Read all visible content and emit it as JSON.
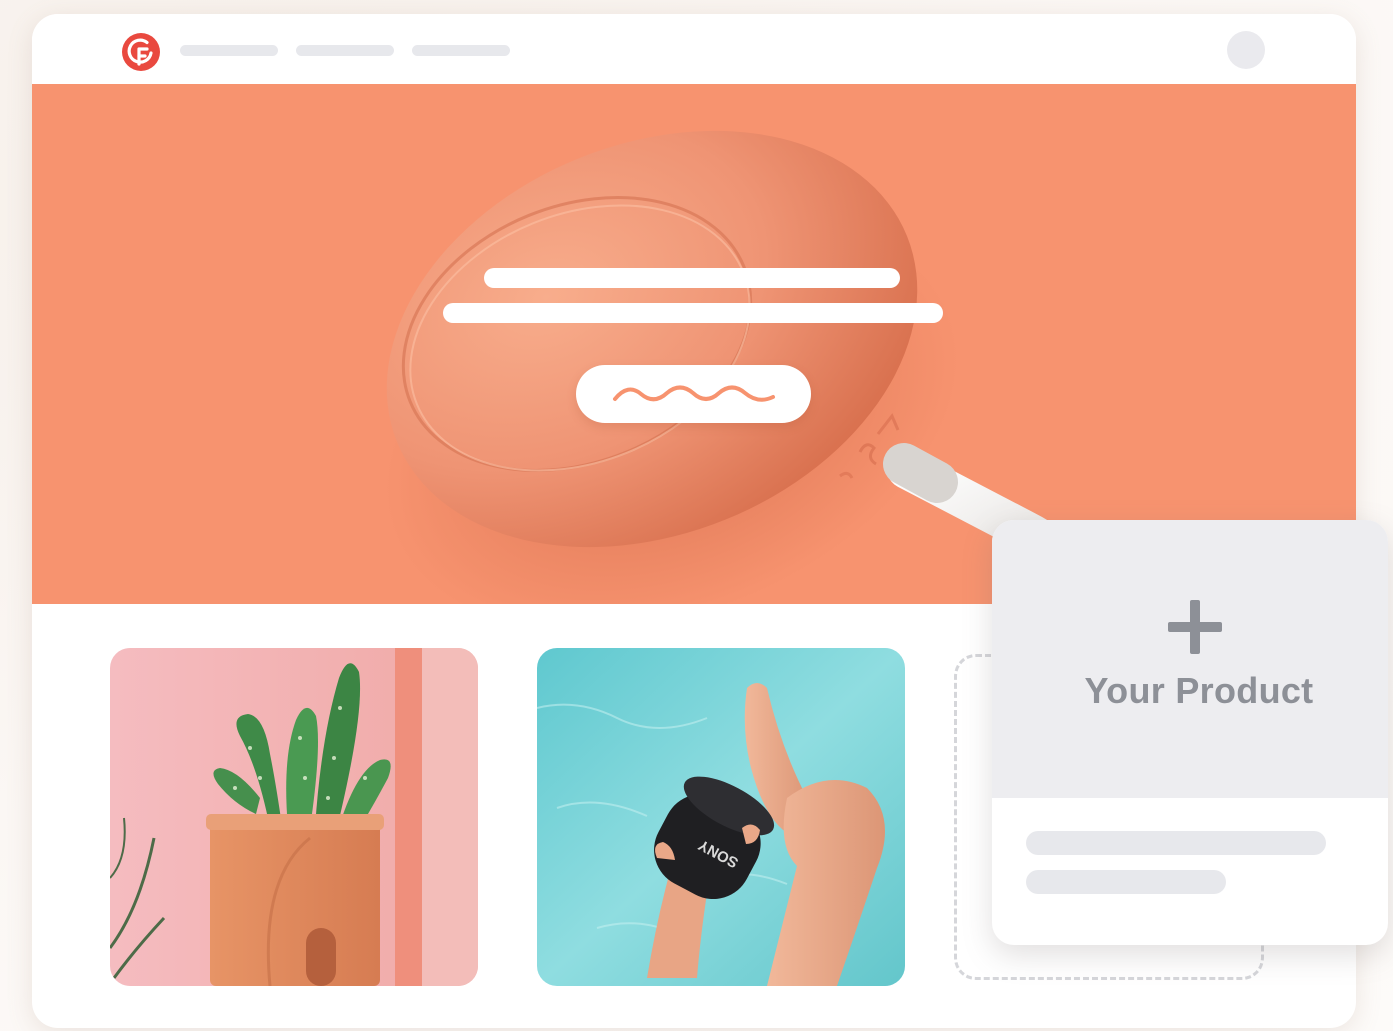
{
  "colors": {
    "hero_background": "#f7936f",
    "logo_red": "#e9493f",
    "placeholder_gray": "#e7e8ec",
    "label_gray": "#8d9097"
  },
  "header": {
    "logo_icon": "brand-logo-icon",
    "avatar_icon": "user-avatar-icon"
  },
  "hero": {
    "cta_icon": "squiggle-icon"
  },
  "add_card": {
    "icon": "plus-icon",
    "label": "Your Product"
  },
  "tiles": {
    "speaker_brand": "SONY"
  }
}
